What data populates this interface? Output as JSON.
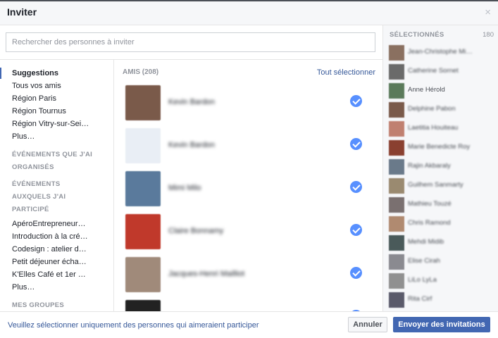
{
  "dialog": {
    "title": "Inviter",
    "close_icon": "×"
  },
  "search": {
    "placeholder": "Rechercher des personnes à inviter"
  },
  "nav": {
    "items_top": [
      "Suggestions",
      "Tous vos amis",
      "Région Paris",
      "Région Tournus",
      "Région Vitry-sur-Sei…",
      "Plus…"
    ],
    "section_organised": "ÉVÉNEMENTS QUE J'AI ORGANISÉS",
    "section_participated": "ÉVÉNEMENTS AUXQUELS J'AI PARTICIPÉ",
    "items_events": [
      "ApéroEntrepreneur…",
      "Introduction à la cré…",
      "Codesign : atelier d…",
      "Petit déjeuner écha…",
      "K'Elles Café et 1er …",
      "Plus…"
    ],
    "section_groups": "MES GROUPES"
  },
  "list": {
    "header": "AMIS (208)",
    "select_all": "Tout sélectionner",
    "friends": [
      {
        "name": "Kevin Bardon",
        "checked": true,
        "avatar_color": "#7a5a4a"
      },
      {
        "name": "Kevin Bardon",
        "checked": true,
        "avatar_color": "#e9eef5"
      },
      {
        "name": "Mimi Milo",
        "checked": true,
        "avatar_color": "#5a7a9c"
      },
      {
        "name": "Claire Bonnamy",
        "checked": true,
        "avatar_color": "#c0392b"
      },
      {
        "name": "Jacques-Henri Mailliot",
        "checked": true,
        "avatar_color": "#a08a7a"
      },
      {
        "name": "",
        "checked": true,
        "avatar_color": "#222222"
      }
    ]
  },
  "selected": {
    "header": "SÉLECTIONNÉS",
    "count": "180",
    "people": [
      {
        "name": "Jean-Christophe Mi…",
        "color": "#8a7060"
      },
      {
        "name": "Catherine Sornet",
        "color": "#6a6a6a"
      },
      {
        "name": "Anne Hérold",
        "color": "#5a7a5a"
      },
      {
        "name": "Delphine Pabon",
        "color": "#7a5a4a"
      },
      {
        "name": "Laetitia Houiteau",
        "color": "#c08070"
      },
      {
        "name": "Marie Benedicte Roy",
        "color": "#8a4030"
      },
      {
        "name": "Rajin Akbaraly",
        "color": "#6a7a8a"
      },
      {
        "name": "Guilhem Sanmarty",
        "color": "#9a8a70"
      },
      {
        "name": "Mathieu Touzé",
        "color": "#7a7070"
      },
      {
        "name": "Chris Ramond",
        "color": "#b08a70"
      },
      {
        "name": "Mehdi Midib",
        "color": "#4a5a5a"
      },
      {
        "name": "Elise Cirah",
        "color": "#8a8a90"
      },
      {
        "name": "LiLo LyLa",
        "color": "#909090"
      },
      {
        "name": "Rita Cirf",
        "color": "#5a5a6a"
      }
    ]
  },
  "footer": {
    "note": "Veuillez sélectionner uniquement des personnes qui aimeraient participer",
    "cancel_label": "Annuler",
    "send_label": "Envoyer des invitations"
  }
}
